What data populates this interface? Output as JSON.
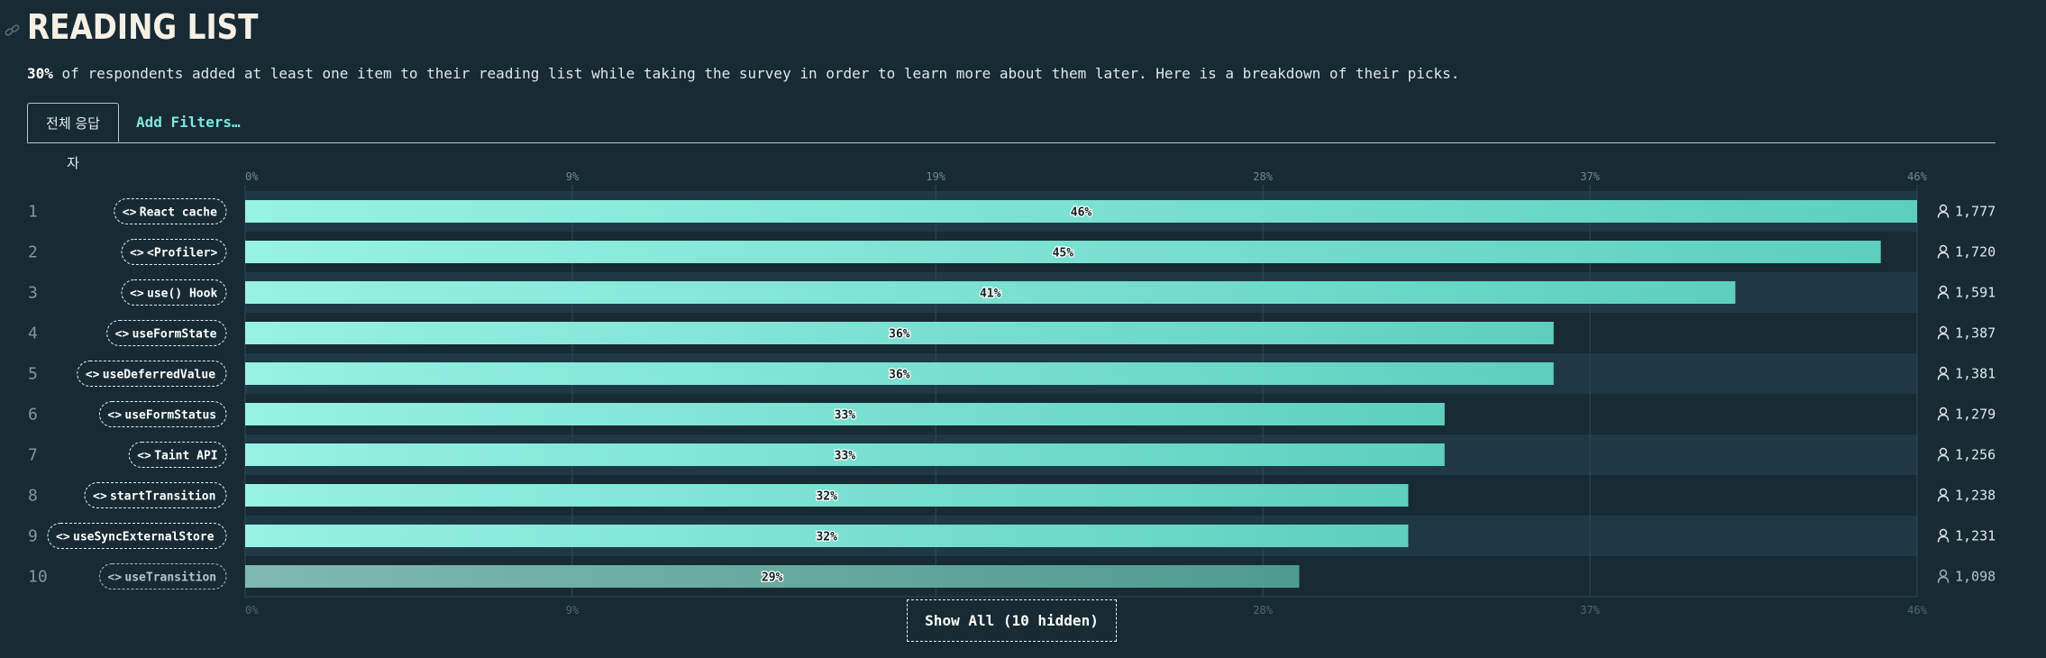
{
  "header": {
    "title": "READING LIST",
    "intro_bold": "30%",
    "intro_rest": " of respondents added at least one item to their reading list while taking the survey in order to learn more about them later. Here is a breakdown of their picks."
  },
  "tabs": {
    "active_label": "전체 응답자",
    "filter_label": "Add Filters…"
  },
  "controls": {
    "show_all_label": "Show All (10 hidden)"
  },
  "colors": {
    "bar_start": "#97f2e3",
    "bar_end": "#5ecfbf",
    "background": "#182a34",
    "band": "#1e3945"
  },
  "chart_data": {
    "type": "bar",
    "orientation": "horizontal",
    "categories": [
      "React cache",
      "<Profiler>",
      "use() Hook",
      "useFormState",
      "useDeferredValue",
      "useFormStatus",
      "Taint API",
      "startTransition",
      "useSyncExternalStore",
      "useTransition"
    ],
    "ranks": [
      "1",
      "2",
      "3",
      "4",
      "5",
      "6",
      "7",
      "8",
      "9",
      "10"
    ],
    "values": [
      46,
      45,
      41,
      36,
      36,
      33,
      33,
      32,
      32,
      29
    ],
    "value_labels": [
      "46%",
      "45%",
      "41%",
      "36%",
      "36%",
      "33%",
      "33%",
      "32%",
      "32%",
      "29%"
    ],
    "counts": [
      "1,777",
      "1,720",
      "1,591",
      "1,387",
      "1,381",
      "1,279",
      "1,256",
      "1,238",
      "1,231",
      "1,098"
    ],
    "ticks": [
      0,
      9,
      19,
      28,
      37,
      46
    ],
    "tick_labels": [
      "0%",
      "9%",
      "19%",
      "28%",
      "37%",
      "46%"
    ],
    "xlim": [
      0,
      46
    ],
    "grid": true
  }
}
